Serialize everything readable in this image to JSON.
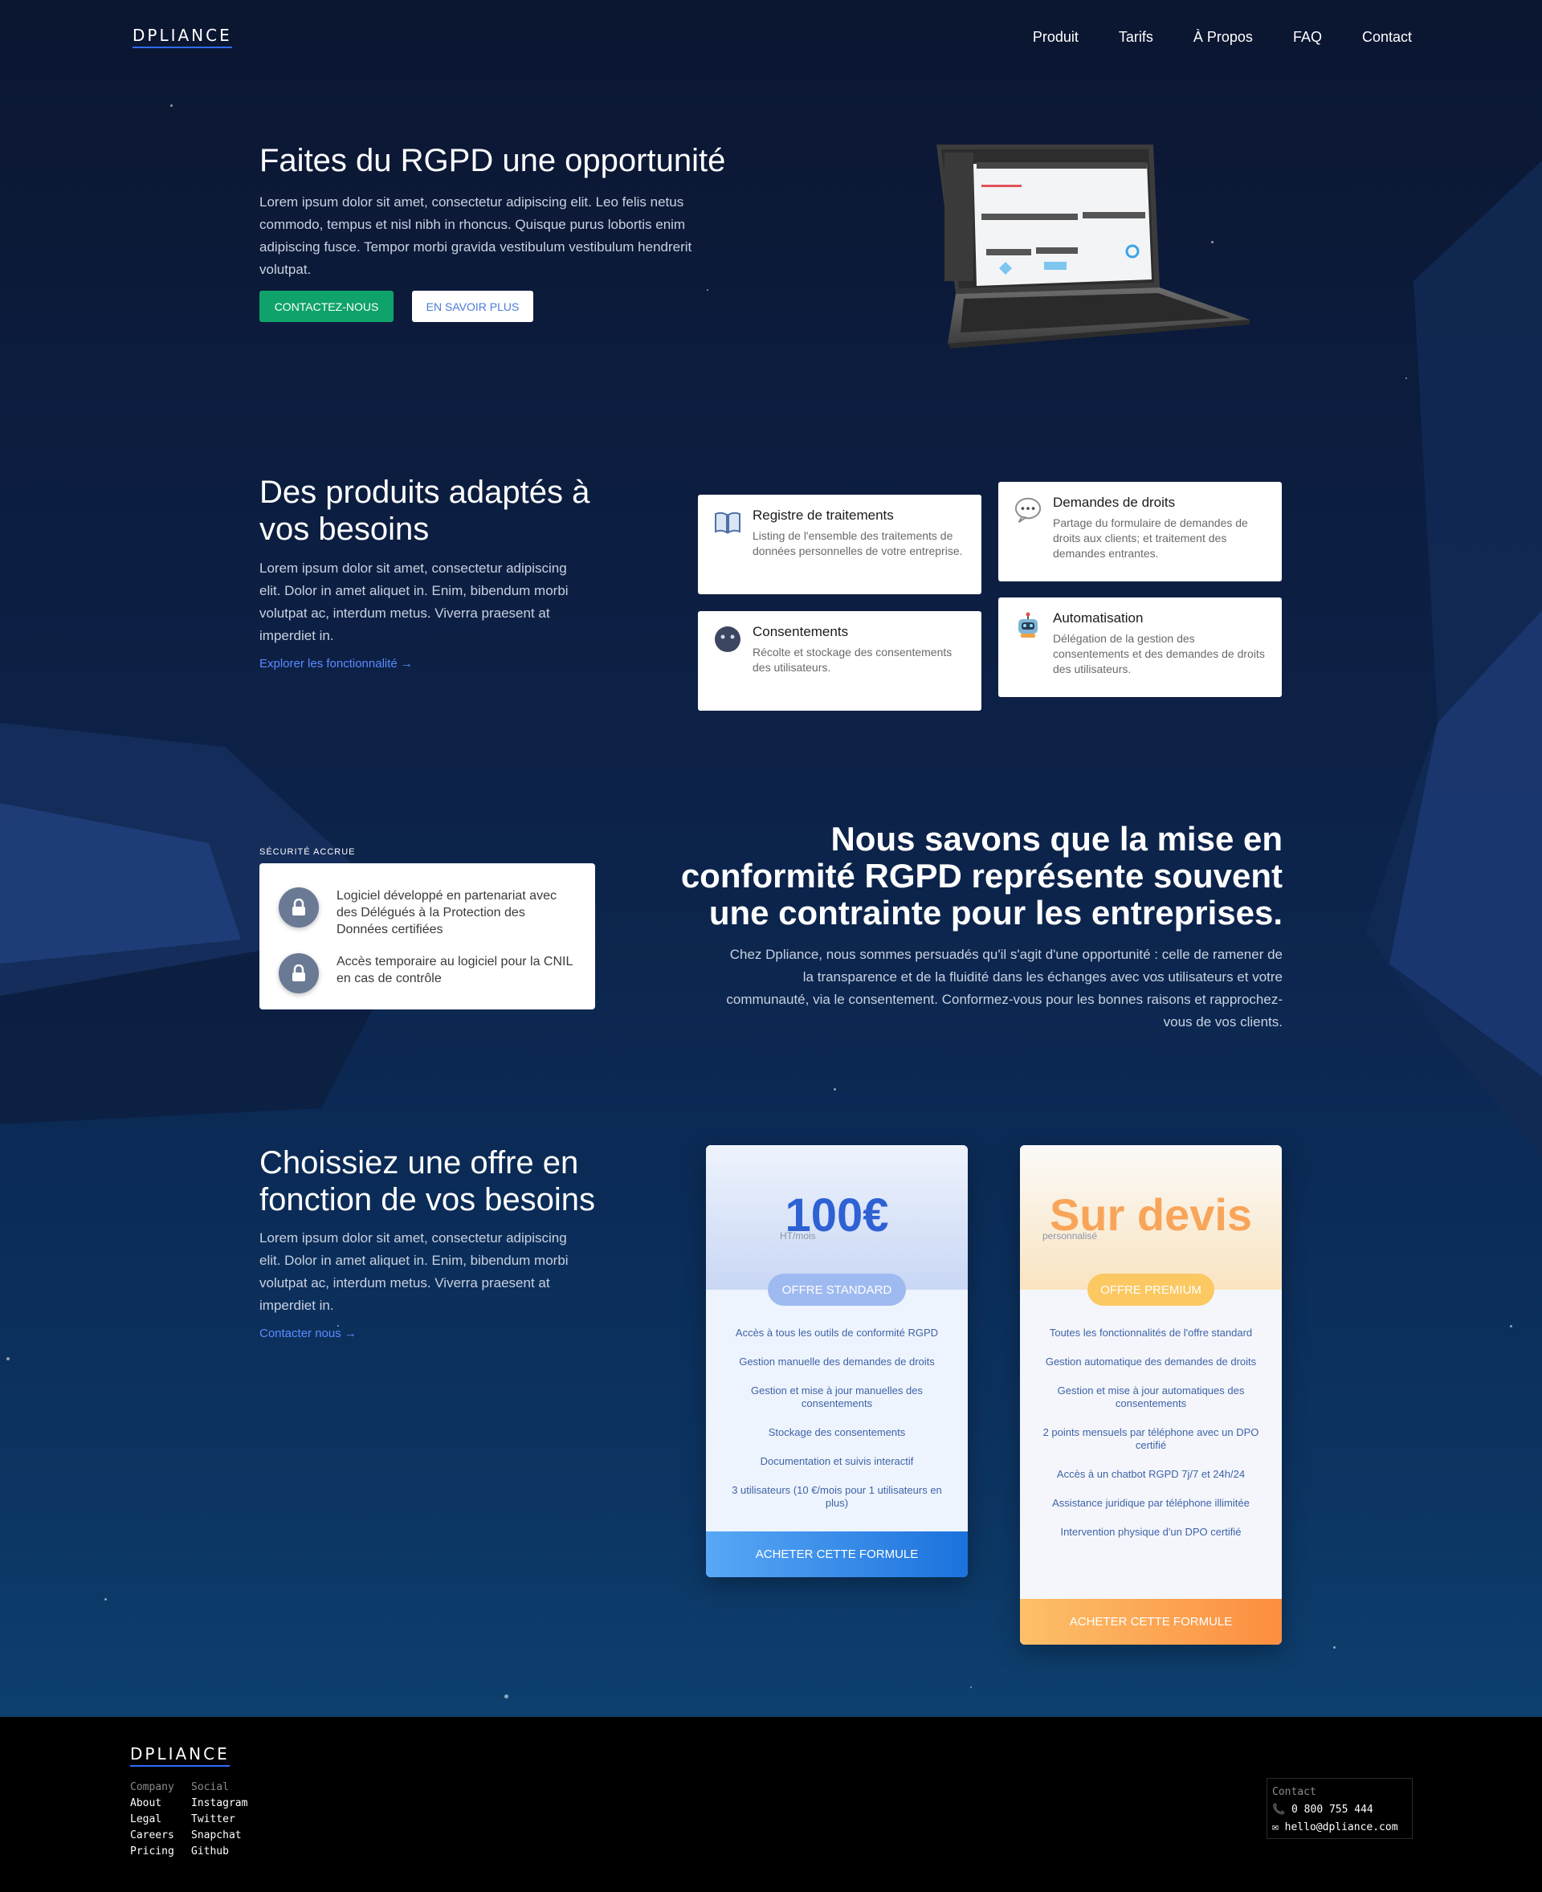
{
  "brand": {
    "name": "DPLIANCE"
  },
  "nav": {
    "items": [
      {
        "label": "Produit"
      },
      {
        "label": "Tarifs"
      },
      {
        "label": "À Propos"
      },
      {
        "label": "FAQ"
      },
      {
        "label": "Contact"
      }
    ]
  },
  "hero": {
    "title": "Faites du RGPD une opportunité",
    "text": "Lorem ipsum dolor sit amet, consectetur adipiscing elit. Leo felis netus commodo, tempus et nisl nibh in rhoncus. Quisque purus lobortis enim adipiscing fusce. Tempor morbi gravida vestibulum vestibulum hendrerit volutpat.",
    "primary_button": "CONTACTEZ-NOUS",
    "secondary_button": "EN SAVOIR PLUS"
  },
  "products": {
    "title": "Des produits adaptés à vos besoins",
    "text": "Lorem ipsum dolor sit amet, consectetur adipiscing elit. Dolor in amet aliquet in. Enim, bibendum morbi volutpat ac, interdum metus. Viverra praesent at imperdiet in.",
    "link": "Explorer les fonctionnalité →",
    "cards": [
      {
        "title": "Registre de traitements",
        "text": "Listing de l'ensemble des traitements de données personnelles de votre entreprise.",
        "icon": "book-icon"
      },
      {
        "title": "Demandes de droits",
        "text": "Partage du formulaire de demandes de droits aux clients; et traitement des demandes entrantes.",
        "icon": "speech-bubble-icon"
      },
      {
        "title": "Consentements",
        "text": "Récolte et stockage des consentements des utilisateurs.",
        "icon": "face-icon"
      },
      {
        "title": "Automatisation",
        "text": "Délégation de la gestion des consentements et des demandes de droits des utilisateurs.",
        "icon": "robot-icon"
      }
    ]
  },
  "security": {
    "label": "SÉCURITÉ ACCRUE",
    "items": [
      {
        "text": "Logiciel développé en partenariat avec des Délégués à la Protection des Données certifiées",
        "icon": "lock-icon"
      },
      {
        "text": "Accès temporaire au logiciel pour la CNIL en cas de contrôle",
        "icon": "lock-icon"
      }
    ]
  },
  "knows": {
    "title": "Nous savons que la mise en conformité RGPD représente souvent une contrainte pour les entreprises.",
    "text": "Chez Dpliance, nous sommes persuadés qu'il s'agit d'une opportunité : celle de ramener de la transparence et de la fluidité dans les échanges avec vos utilisateurs et votre communauté, via le consentement. Conformez-vous pour les bonnes raisons et rapprochez-vous de vos clients."
  },
  "pricing": {
    "title": "Choissiez une offre en fonction de vos besoins",
    "text": "Lorem ipsum dolor sit amet, consectetur adipiscing elit. Dolor in amet aliquet in. Enim, bibendum morbi volutpat ac, interdum metus. Viverra praesent at imperdiet in.",
    "link": "Contacter nous →",
    "plans": [
      {
        "price": "100€",
        "sub": "HT/mois",
        "badge": "OFFRE STANDARD",
        "features": [
          "Accès à tous les outils de conformité RGPD",
          "Gestion manuelle des demandes de droits",
          "Gestion et mise à jour manuelles des consentements",
          "Stockage des consentements",
          "Documentation et suivis interactif",
          "3 utilisateurs (10 €/mois pour 1 utilisateurs en plus)"
        ],
        "button": "ACHETER CETTE FORMULE"
      },
      {
        "price": "Sur devis",
        "sub": "personnalisé",
        "badge": "OFFRE PREMIUM",
        "features": [
          "Toutes les fonctionnalités de l'offre standard",
          "Gestion automatique des demandes de droits",
          "Gestion et mise à jour automatiques des consentements",
          "2 points mensuels par téléphone avec un DPO certifié",
          "Accès à un chatbot RGPD 7j/7 et 24h/24",
          "Assistance juridique par téléphone illimitée",
          "Intervention physique d'un DPO certifié"
        ],
        "button": "ACHETER CETTE FORMULE"
      }
    ]
  },
  "footer": {
    "company": {
      "heading": "Company",
      "links": [
        "About",
        "Legal",
        "Careers",
        "Pricing"
      ]
    },
    "social": {
      "heading": "Social",
      "links": [
        "Instagram",
        "Twitter",
        "Snapchat",
        "Github"
      ]
    },
    "contact": {
      "heading": "Contact",
      "phone": "📞 0 800 755 444",
      "email": "✉ hello@dpliance.com"
    }
  },
  "colors": {
    "accent": "#2f6bff",
    "primary_button": "#0fa36b",
    "standard_price": "#2e62d4",
    "premium_price": "#f8a55a"
  }
}
